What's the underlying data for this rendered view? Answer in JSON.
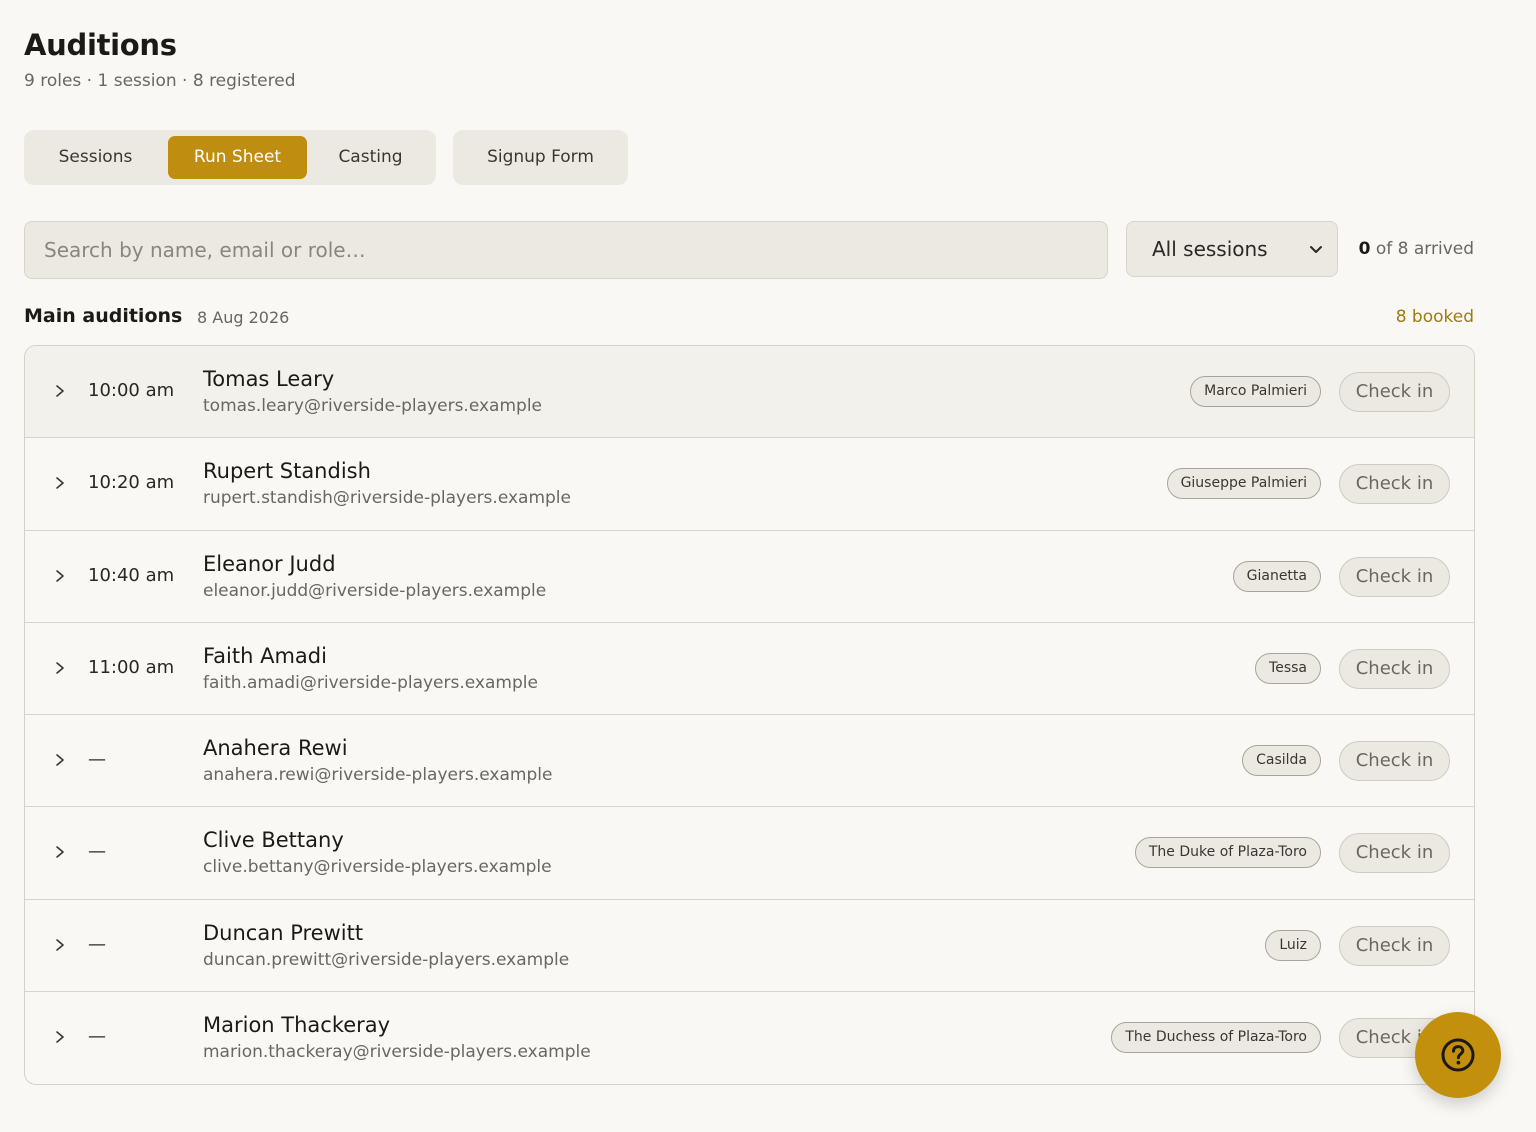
{
  "header": {
    "title": "Auditions",
    "subtitle": "9 roles · 1 session · 8 registered"
  },
  "tabs": [
    {
      "label": "Sessions"
    },
    {
      "label": "Run Sheet",
      "active": true
    },
    {
      "label": "Casting"
    }
  ],
  "signup_form": {
    "label": "Signup Form"
  },
  "search": {
    "placeholder": "Search by name, email or role…",
    "value": ""
  },
  "session_filter": {
    "selected": "All sessions"
  },
  "arrival": {
    "count": "0",
    "suffix": "of 8 arrived"
  },
  "section": {
    "title": "Main auditions",
    "date": "8 Aug 2026",
    "booked": "8 booked"
  },
  "check_in_label": "Check in",
  "auditionees": [
    {
      "time": "10:00 am",
      "name": "Tomas Leary",
      "email": "tomas.leary@riverside-players.example",
      "role": "Marco Palmieri"
    },
    {
      "time": "10:20 am",
      "name": "Rupert Standish",
      "email": "rupert.standish@riverside-players.example",
      "role": "Giuseppe Palmieri"
    },
    {
      "time": "10:40 am",
      "name": "Eleanor Judd",
      "email": "eleanor.judd@riverside-players.example",
      "role": "Gianetta"
    },
    {
      "time": "11:00 am",
      "name": "Faith Amadi",
      "email": "faith.amadi@riverside-players.example",
      "role": "Tessa"
    },
    {
      "time": "—",
      "name": "Anahera Rewi",
      "email": "anahera.rewi@riverside-players.example",
      "role": "Casilda"
    },
    {
      "time": "—",
      "name": "Clive Bettany",
      "email": "clive.bettany@riverside-players.example",
      "role": "The Duke of Plaza-Toro"
    },
    {
      "time": "—",
      "name": "Duncan Prewitt",
      "email": "duncan.prewitt@riverside-players.example",
      "role": "Luiz"
    },
    {
      "time": "—",
      "name": "Marion Thackeray",
      "email": "marion.thackeray@riverside-players.example",
      "role": "The Duchess of Plaza-Toro"
    }
  ],
  "icons": {
    "row_expand": "chevron-right-icon",
    "select": "chevron-down-icon",
    "help": "question-circle-icon"
  },
  "colors": {
    "accent": "#bf8d10",
    "background": "#f9f8f5",
    "surface": "#ece9e3",
    "booked_text": "#a07a12"
  }
}
